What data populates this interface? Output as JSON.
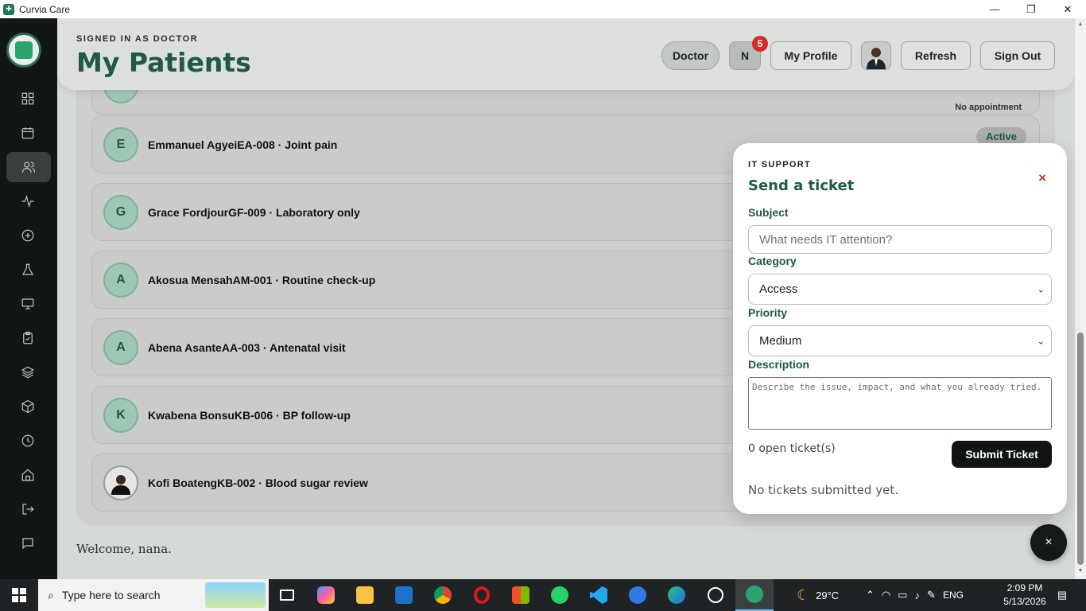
{
  "window": {
    "title": "Curvia Care"
  },
  "header": {
    "signed_in_label": "SIGNED IN AS DOCTOR",
    "page_title": "My Patients",
    "role_label": "Doctor",
    "notifications_initial": "N",
    "notifications_count": "5",
    "profile_label": "My Profile",
    "refresh_label": "Refresh",
    "signout_label": "Sign Out"
  },
  "patients": [
    {
      "initial": "",
      "name": "",
      "status": "No appointment"
    },
    {
      "initial": "E",
      "name": "Emmanuel AgyeiEA-008 · Joint pain",
      "status": "Active"
    },
    {
      "initial": "G",
      "name": "Grace FordjourGF-009 · Laboratory only",
      "status": ""
    },
    {
      "initial": "A",
      "name": "Akosua MensahAM-001 · Routine check-up",
      "status": ""
    },
    {
      "initial": "A",
      "name": "Abena AsanteAA-003 · Antenatal visit",
      "status": ""
    },
    {
      "initial": "K",
      "name": "Kwabena BonsuKB-006 · BP follow-up",
      "status": ""
    },
    {
      "initial": "",
      "name": "Kofi BoatengKB-002 · Blood sugar review",
      "status": ""
    }
  ],
  "welcome_text": "Welcome, nana.",
  "ticket_modal": {
    "kicker": "IT SUPPORT",
    "title": "Send a ticket",
    "close_symbol": "×",
    "subject_label": "Subject",
    "subject_placeholder": "What needs IT attention?",
    "category_label": "Category",
    "category_value": "Access",
    "priority_label": "Priority",
    "priority_value": "Medium",
    "description_label": "Description",
    "description_placeholder": "Describe the issue, impact, and what you already tried.",
    "open_count_text": "0 open ticket(s)",
    "submit_label": "Submit Ticket",
    "empty_text": "No tickets submitted yet."
  },
  "fab_symbol": "×",
  "taskbar": {
    "search_placeholder": "Type here to search",
    "weather": "29°C",
    "language": "ENG",
    "time": "2:09 PM",
    "date": "5/13/2026"
  },
  "colors": {
    "accent": "#1e5a44",
    "sidebar": "#121614",
    "badge": "#d62b2b"
  },
  "sidebar_icons": [
    "grid-icon",
    "calendar-icon",
    "users-icon",
    "activity-icon",
    "plus-circle-icon",
    "flask-icon",
    "monitor-icon",
    "clipboard-icon",
    "layers-icon",
    "box-icon",
    "clock-icon",
    "home-icon",
    "logout-icon",
    "message-icon"
  ]
}
